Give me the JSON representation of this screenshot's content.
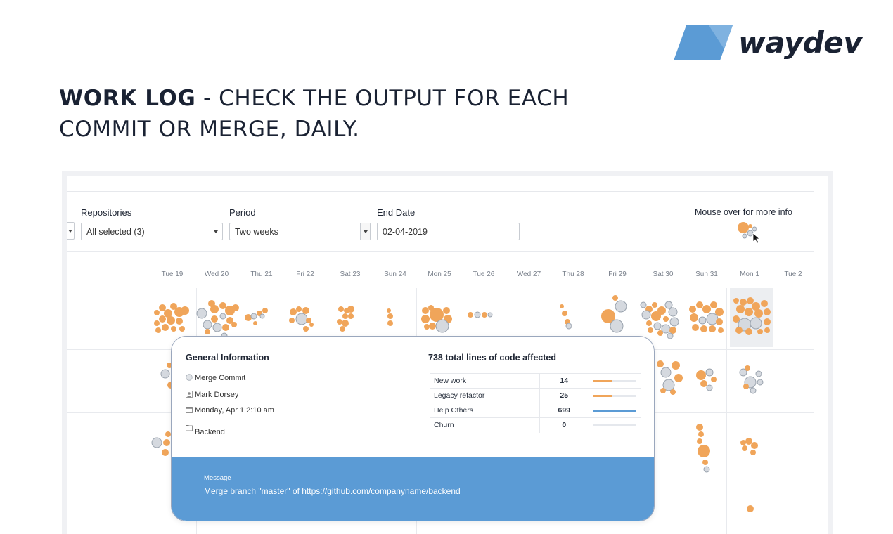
{
  "brand": {
    "name": "waydev",
    "color": "#5b9bd5"
  },
  "headline": {
    "strong": "WORK LOG",
    "rest": " - CHECK THE OUTPUT FOR EACH COMMIT OR MERGE, DAILY."
  },
  "filters": {
    "repositories": {
      "label": "Repositories",
      "value": "All selected (3)"
    },
    "period": {
      "label": "Period",
      "value": "Two weeks"
    },
    "end_date": {
      "label": "End Date",
      "value": "02-04-2019"
    },
    "hint": "Mouse over for more info"
  },
  "days": [
    "Tue 19",
    "Wed 20",
    "Thu 21",
    "Fri 22",
    "Sat 23",
    "Sun 24",
    "Mon 25",
    "Tue 26",
    "Wed 27",
    "Thu 28",
    "Fri 29",
    "Sat 30",
    "Sun 31",
    "Mon 1",
    "Tue 2"
  ],
  "colors": {
    "commit": "#f0a55a",
    "merge": "#d5d9df",
    "merge_stroke": "#9aa3ae"
  },
  "tooltip": {
    "general_title": "General Information",
    "type": "Merge Commit",
    "author": "Mark Dorsey",
    "date": "Monday, Apr 1 2:10 am",
    "repo": "Backend",
    "stats_title": "738 total lines of code affected",
    "stats": [
      {
        "label": "New work",
        "value": "14",
        "fill": 0.45,
        "color": "#f0a55a"
      },
      {
        "label": "Legacy refactor",
        "value": "25",
        "fill": 0.45,
        "color": "#f0a55a"
      },
      {
        "label": "Help Others",
        "value": "699",
        "fill": 1.0,
        "color": "#5b9bd5"
      },
      {
        "label": "Churn",
        "value": "0",
        "fill": 0,
        "color": "#e5e8ed"
      }
    ],
    "message_label": "Message",
    "message": "Merge branch \"master\" of https://github.com/companyname/backend"
  }
}
